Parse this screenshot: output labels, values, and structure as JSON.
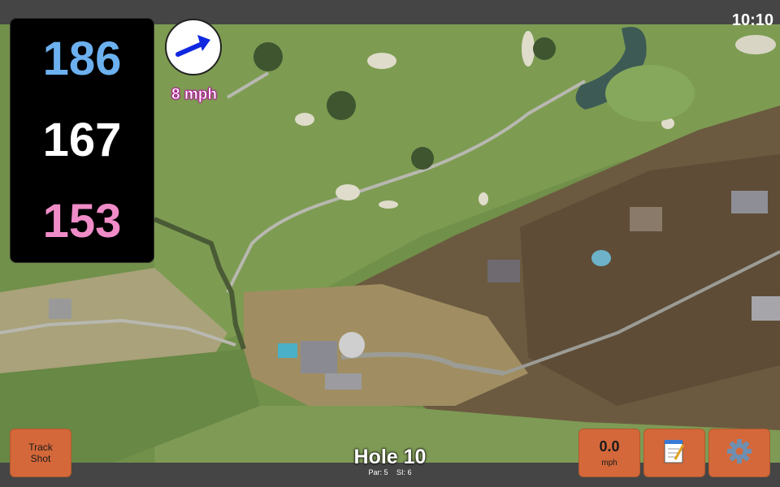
{
  "clock": "10:10",
  "yardages": {
    "back": "186",
    "middle": "167",
    "front": "153"
  },
  "wind": {
    "speed": "8 mph",
    "icon": "wind-arrow-icon"
  },
  "track_shot": {
    "line1": "Track",
    "line2": "Shot"
  },
  "speed_button": {
    "value": "0.0",
    "unit": "mph"
  },
  "notes_button": {
    "icon": "notepad-icon"
  },
  "settings_button": {
    "icon": "gear-icon"
  },
  "hole": {
    "title": "Hole 10",
    "par": "Par: 5",
    "si": "SI: 6"
  },
  "colors": {
    "back": "#6cb0f0",
    "middle": "#ffffff",
    "front": "#f08cc8",
    "button": "#d4683a"
  }
}
